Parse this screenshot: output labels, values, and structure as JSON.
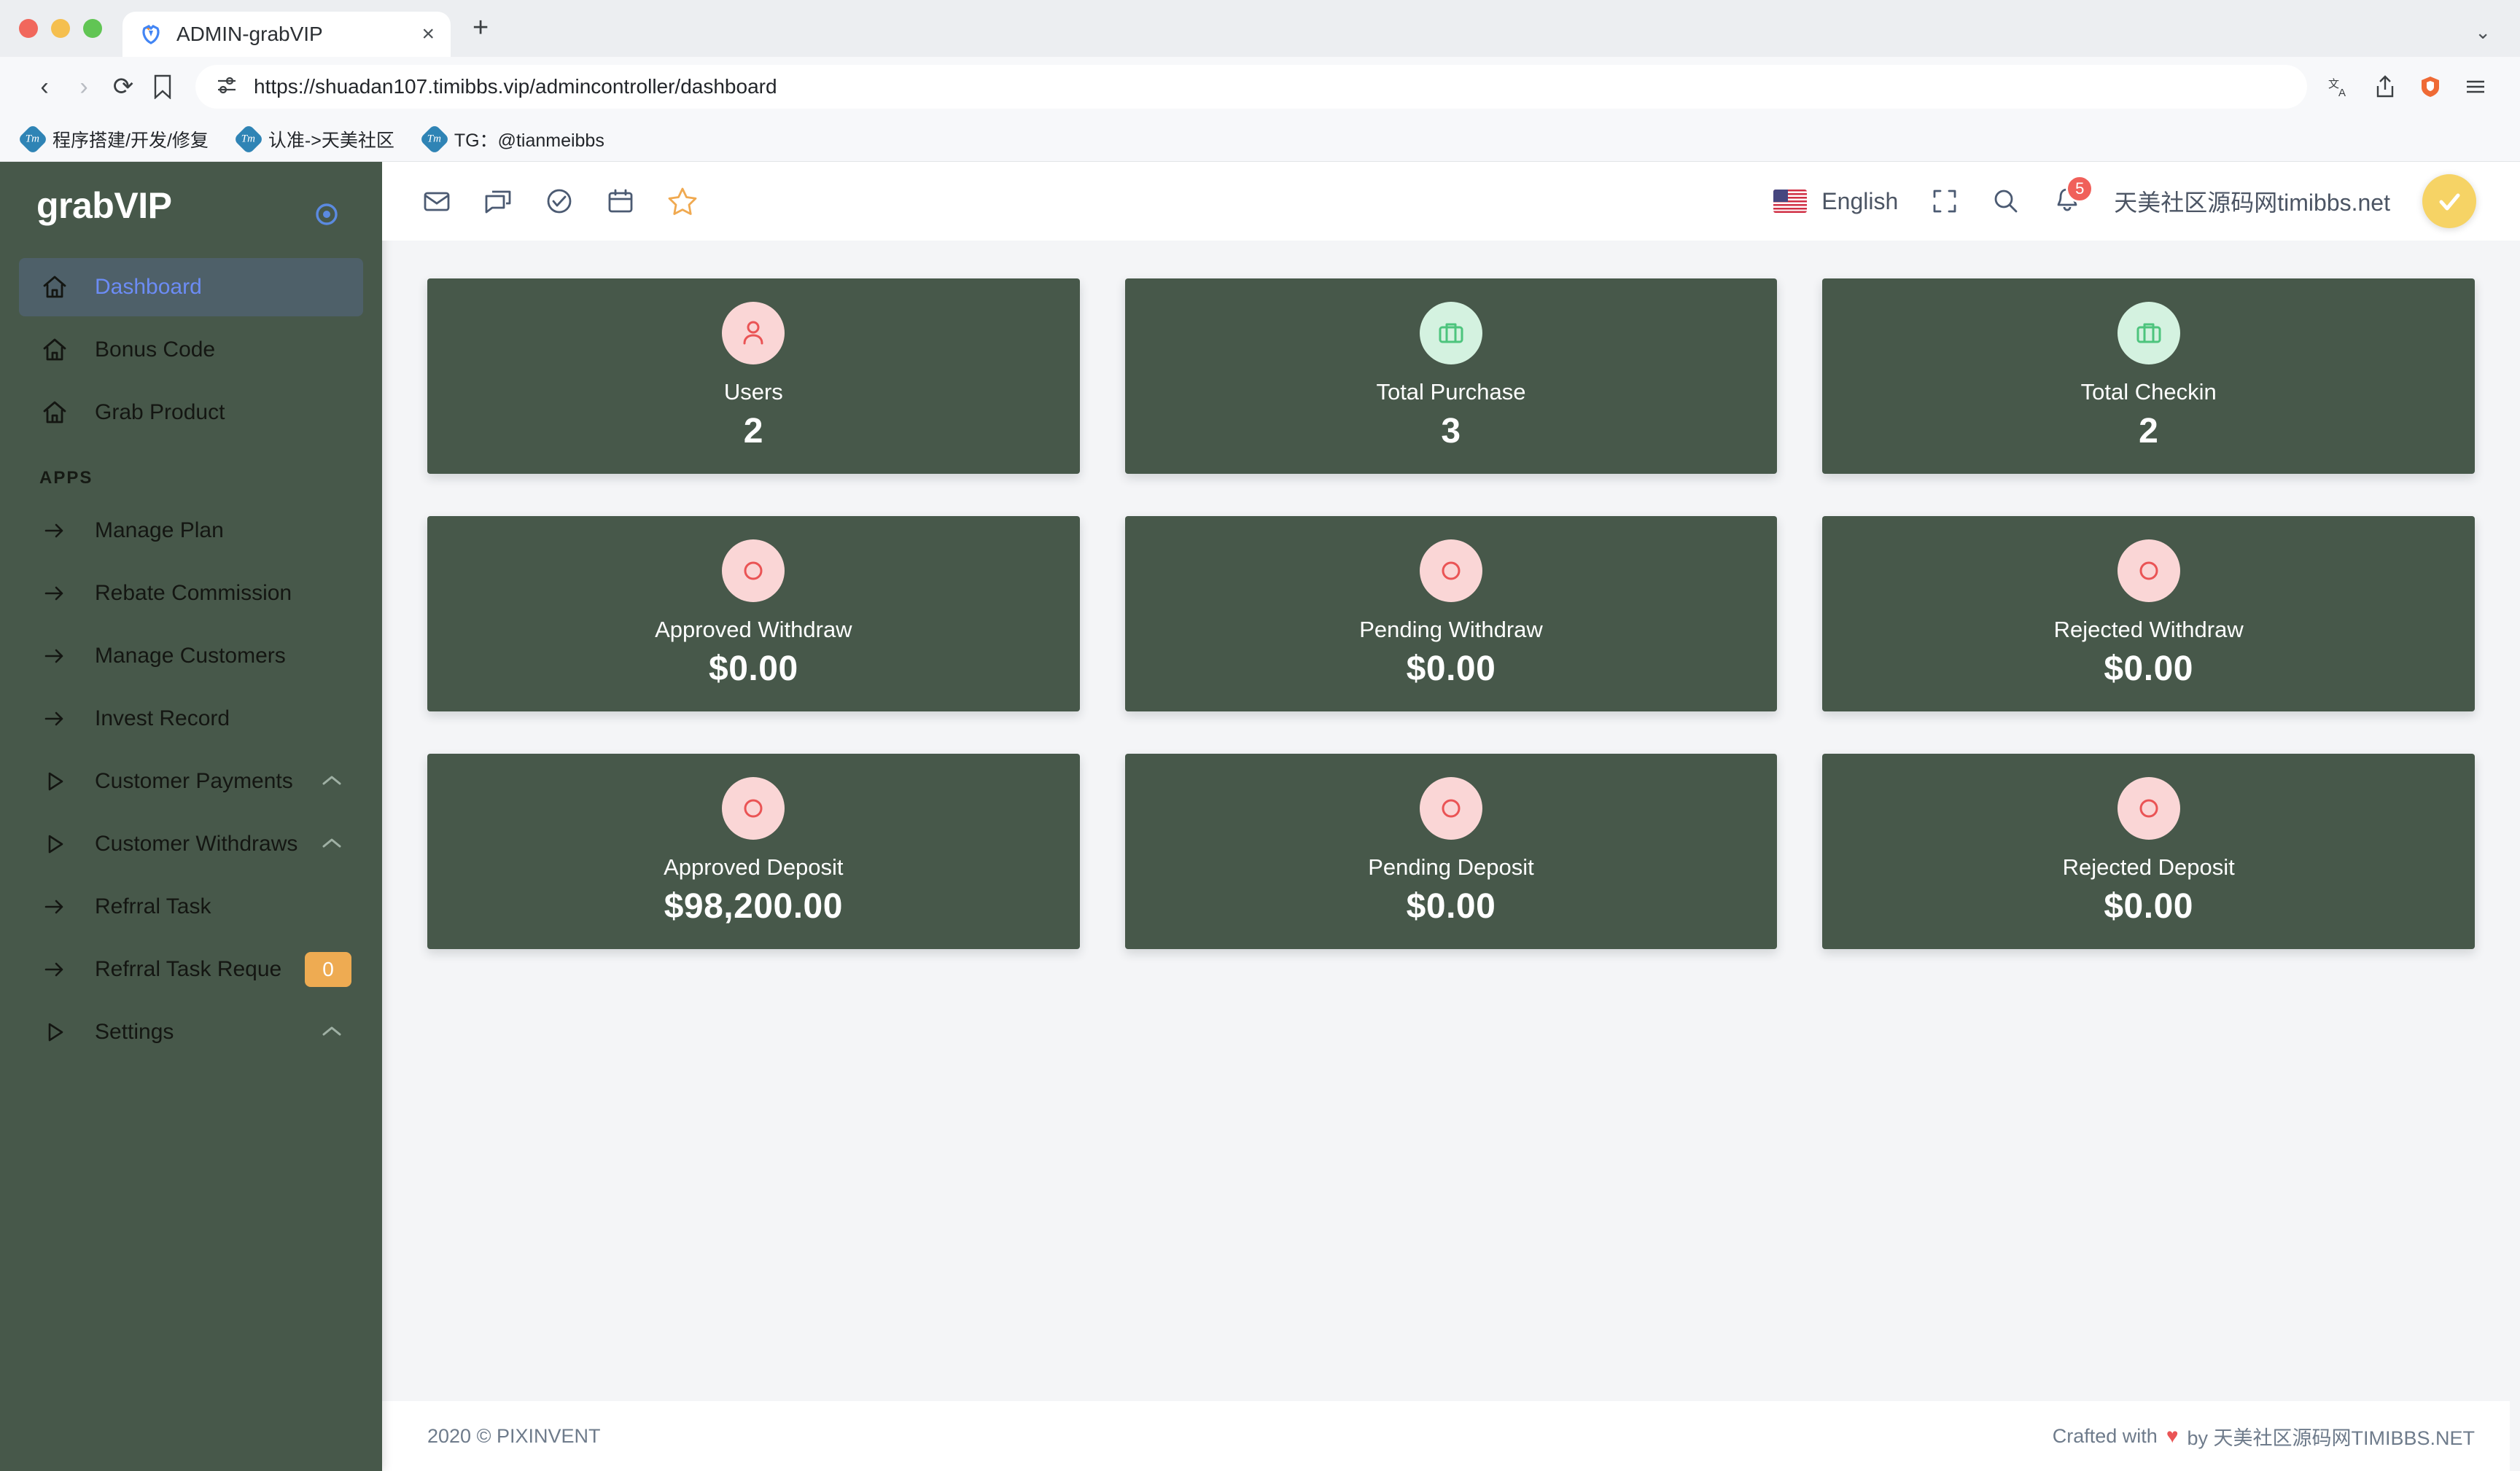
{
  "browser": {
    "tab": {
      "title": "ADMIN-grabVIP",
      "close_label": "×",
      "favicon": "brave-favicon"
    },
    "new_tab_label": "+",
    "window_chevron": "⌄",
    "nav": {
      "back": "‹",
      "forward": "›",
      "reload": "⟳",
      "bookmark": "bookmark-icon"
    },
    "url": "https://shuadan107.timibbs.vip/admincontroller/dashboard",
    "toolbar_icons": [
      "translate-icon",
      "share-icon",
      "brave-shield-icon",
      "menu-icon"
    ],
    "bookmarks": [
      {
        "label": "程序搭建/开发/修复",
        "icon_text": "Tm"
      },
      {
        "label": "认准->天美社区",
        "icon_text": "Tm"
      },
      {
        "label": "TG：@tianmeibbs",
        "icon_text": "Tm"
      }
    ]
  },
  "sidebar": {
    "brand": "grabVIP",
    "pin_icon": "circle-dot-icon",
    "items": [
      {
        "label": "Dashboard",
        "icon": "home-icon",
        "active": true,
        "caret": null,
        "badge": null
      },
      {
        "label": "Bonus Code",
        "icon": "home-icon",
        "active": false,
        "caret": null,
        "badge": null
      },
      {
        "label": "Grab Product",
        "icon": "home-icon",
        "active": false,
        "caret": null,
        "badge": null
      }
    ],
    "section_label": "APPS",
    "app_items": [
      {
        "label": "Manage Plan",
        "icon": "arrow-right-icon",
        "caret": null,
        "badge": null
      },
      {
        "label": "Rebate Commission",
        "icon": "arrow-right-icon",
        "caret": null,
        "badge": null
      },
      {
        "label": "Manage Customers",
        "icon": "arrow-right-icon",
        "caret": null,
        "badge": null
      },
      {
        "label": "Invest Record",
        "icon": "arrow-right-icon",
        "caret": null,
        "badge": null
      },
      {
        "label": "Customer Payments",
        "icon": "triangle-right-icon",
        "caret": "chevron-up",
        "badge": null
      },
      {
        "label": "Customer Withdraws",
        "icon": "triangle-right-icon",
        "caret": "chevron-up",
        "badge": null
      },
      {
        "label": "Refrral Task",
        "icon": "arrow-right-icon",
        "caret": null,
        "badge": null
      },
      {
        "label": "Refrral Task Reque",
        "icon": "arrow-right-icon",
        "caret": null,
        "badge": "0"
      },
      {
        "label": "Settings",
        "icon": "triangle-right-icon",
        "caret": "chevron-up",
        "badge": null
      }
    ]
  },
  "topbar": {
    "left_icons": [
      {
        "name": "mail-icon"
      },
      {
        "name": "chat-icon"
      },
      {
        "name": "check-circle-icon"
      },
      {
        "name": "calendar-icon"
      },
      {
        "name": "star-icon"
      }
    ],
    "language": "English",
    "flag": "us-flag-icon",
    "fullscreen_icon": "fullscreen-icon",
    "search_icon": "search-icon",
    "bell_icon": "bell-icon",
    "bell_count": "5",
    "user_name": "天美社区源码网timibbs.net",
    "avatar_icon": "check-avatar-icon"
  },
  "cards": [
    {
      "title": "Users",
      "value": "2",
      "icon": "user-icon",
      "icon_style": "pink"
    },
    {
      "title": "Total Purchase",
      "value": "3",
      "icon": "briefcase-icon",
      "icon_style": "greenish"
    },
    {
      "title": "Total Checkin",
      "value": "2",
      "icon": "briefcase-icon",
      "icon_style": "greenish"
    },
    {
      "title": "Approved Withdraw",
      "value": "$0.00",
      "icon": "circle-icon",
      "icon_style": "pink"
    },
    {
      "title": "Pending Withdraw",
      "value": "$0.00",
      "icon": "circle-icon",
      "icon_style": "pink"
    },
    {
      "title": "Rejected Withdraw",
      "value": "$0.00",
      "icon": "circle-icon",
      "icon_style": "pink"
    },
    {
      "title": "Approved Deposit",
      "value": "$98,200.00",
      "icon": "circle-icon",
      "icon_style": "pink"
    },
    {
      "title": "Pending Deposit",
      "value": "$0.00",
      "icon": "circle-icon",
      "icon_style": "pink"
    },
    {
      "title": "Rejected Deposit",
      "value": "$0.00",
      "icon": "circle-icon",
      "icon_style": "pink"
    }
  ],
  "footer": {
    "left": "2020 © PIXINVENT",
    "crafted_prefix": "Crafted with",
    "heart": "♥",
    "crafted_by": "by 天美社区源码网TIMIBBS.NET"
  },
  "colors": {
    "sidebar_bg": "#47584a",
    "card_bg": "#47584a",
    "active_bg": "#4e6069",
    "active_text": "#6c8cf5",
    "badge_orange": "#eeab52",
    "bell_red": "#f0605a",
    "icon_pink_bg": "#fad6d6",
    "icon_pink_fg": "#ea5455",
    "icon_green_bg": "#d4f2e0",
    "icon_green_fg": "#4dc47d",
    "star_orange": "#f0a950",
    "page_bg": "#f4f5f7"
  }
}
